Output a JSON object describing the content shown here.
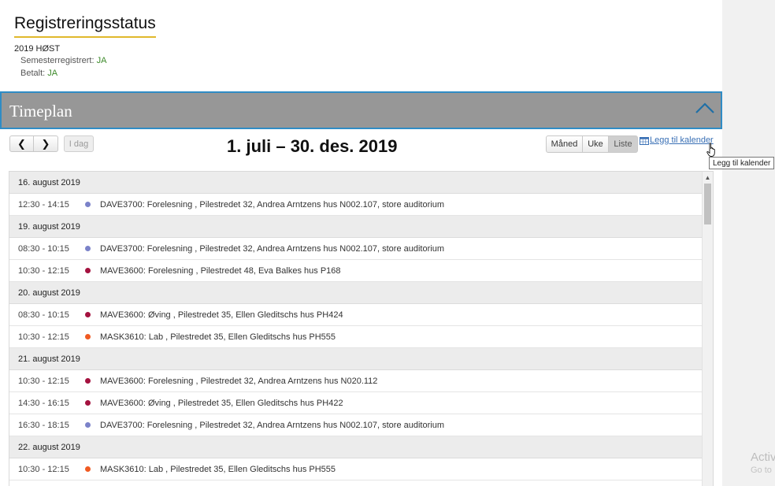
{
  "status": {
    "title": "Registreringsstatus",
    "semester": "2019 HØST",
    "semester_registered_label": "Semesterregistrert: ",
    "semester_registered_value": "JA",
    "paid_label": "Betalt: ",
    "paid_value": "JA"
  },
  "timeplan": {
    "title": "Timeplan",
    "collapse_icon": "chevron-up-icon"
  },
  "toolbar": {
    "prev_icon": "chevron-left-icon",
    "prev_symbol": "❮",
    "next_icon": "chevron-right-icon",
    "next_symbol": "❯",
    "today_label": "I dag",
    "date_range": "1. juli – 30. des. 2019",
    "views": [
      {
        "label": "Måned",
        "active": false
      },
      {
        "label": "Uke",
        "active": false
      },
      {
        "label": "Liste",
        "active": true
      }
    ],
    "calendar_link": "Legg til kalender",
    "calendar_icon": "calendar-icon",
    "tooltip": "Legg til kalender"
  },
  "colors": {
    "accent_underline": "#e0b92c",
    "timeplan_border": "#2f8cc5",
    "status_yes": "#3d8a2a",
    "DAVE3700": "#7b82c9",
    "MAVE3600": "#a4123f",
    "MASK3610": "#f05a22"
  },
  "schedule": [
    {
      "date": "16. august 2019",
      "events": [
        {
          "time": "12:30 - 14:15",
          "course": "DAVE3700",
          "title": "DAVE3700: Forelesning , Pilestredet 32, Andrea Arntzens hus N002.107, store auditorium"
        }
      ]
    },
    {
      "date": "19. august 2019",
      "events": [
        {
          "time": "08:30 - 10:15",
          "course": "DAVE3700",
          "title": "DAVE3700: Forelesning , Pilestredet 32, Andrea Arntzens hus N002.107, store auditorium"
        },
        {
          "time": "10:30 - 12:15",
          "course": "MAVE3600",
          "title": "MAVE3600: Forelesning , Pilestredet 48, Eva Balkes hus P168"
        }
      ]
    },
    {
      "date": "20. august 2019",
      "events": [
        {
          "time": "08:30 - 10:15",
          "course": "MAVE3600",
          "title": "MAVE3600: Øving , Pilestredet 35, Ellen Gleditschs hus PH424"
        },
        {
          "time": "10:30 - 12:15",
          "course": "MASK3610",
          "title": "MASK3610: Lab , Pilestredet 35, Ellen Gleditschs hus PH555"
        }
      ]
    },
    {
      "date": "21. august 2019",
      "events": [
        {
          "time": "10:30 - 12:15",
          "course": "MAVE3600",
          "title": "MAVE3600: Forelesning , Pilestredet 32, Andrea Arntzens hus N020.112"
        },
        {
          "time": "14:30 - 16:15",
          "course": "MAVE3600",
          "title": "MAVE3600: Øving , Pilestredet 35, Ellen Gleditschs hus PH422"
        },
        {
          "time": "16:30 - 18:15",
          "course": "DAVE3700",
          "title": "DAVE3700: Forelesning , Pilestredet 32, Andrea Arntzens hus N002.107, store auditorium"
        }
      ]
    },
    {
      "date": "22. august 2019",
      "events": [
        {
          "time": "10:30 - 12:15",
          "course": "MASK3610",
          "title": "MASK3610: Lab , Pilestredet 35, Ellen Gleditschs hus PH555"
        }
      ]
    }
  ],
  "scrollbar": {
    "up_symbol": "▲"
  },
  "watermark": {
    "line1": "Activ",
    "line2": "Go to"
  }
}
